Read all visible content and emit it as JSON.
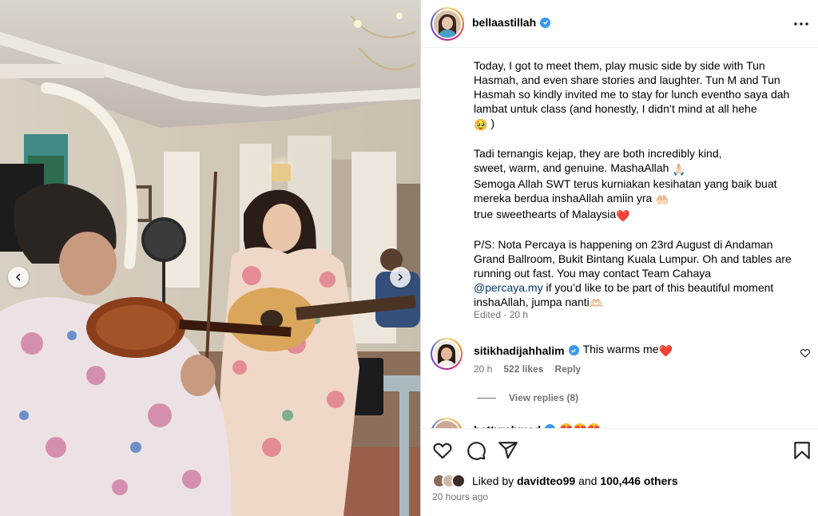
{
  "colors": {
    "link": "#00376b",
    "muted": "#737373",
    "verified": "#3897f0",
    "heart": "#e0245e"
  },
  "media": {
    "prev_icon": "chevron-left-icon",
    "next_icon": "chevron-right-icon"
  },
  "header": {
    "username": "bellaastillah",
    "more_icon": "more-horizontal-icon"
  },
  "caption": {
    "p1": "Today, I got to meet them, play music side by side with Tun Hasmah, and even share stories and laughter. Tun M and Tun Hasmah so kindly invited me to stay for lunch eventho saya dah lambat untuk class (and honestly, I didn’t mind at all hehe",
    "p1_emoji": "🥹",
    "p1_end": ")",
    "p2_l1": "Tadi ternangis kejap, they are both incredibly kind,",
    "p2_l2": "sweet, warm, and genuine. MashaAllah",
    "p2_l2_emoji": "🙏🏻",
    "p2_l3": "Semoga Allah SWT terus kurniakan kesihatan yang baik buat mereka berdua inshaAllah amiin yra",
    "p2_l3_emoji": "🤲🏻",
    "p2_l4": "true sweethearts of Malaysia",
    "p2_l4_emoji": "❤️",
    "p3_a": "P/S: Nota Percaya is happening on 23rd August di Andaman Grand Ballroom, Bukit Bintang Kuala Lumpur. Oh and tables are running out fast. You may contact Team Cahaya",
    "p3_mention": "@percaya.my",
    "p3_b": "if you’d like to be part of this beautiful moment inshaAllah, jumpa nanti",
    "p3_emoji": "🫶🏻",
    "edited": "Edited · 20 h"
  },
  "comments": [
    {
      "username": "sitikhadijahhalim",
      "text": "This warms me",
      "text_emoji": "❤️",
      "time": "20 h",
      "likes": "522 likes",
      "reply": "Reply",
      "view_replies": "View replies (8)"
    },
    {
      "username": "bettyrahmad",
      "text_emoji": "😍😍😍"
    }
  ],
  "actions": {
    "like_icon": "heart-icon",
    "comment_icon": "comment-icon",
    "share_icon": "share-icon",
    "save_icon": "bookmark-icon",
    "liked_by_prefix": "Liked by",
    "liked_by_user": "davidteo99",
    "and": "and",
    "others": "100,446 others",
    "time_ago": "20 hours ago"
  }
}
